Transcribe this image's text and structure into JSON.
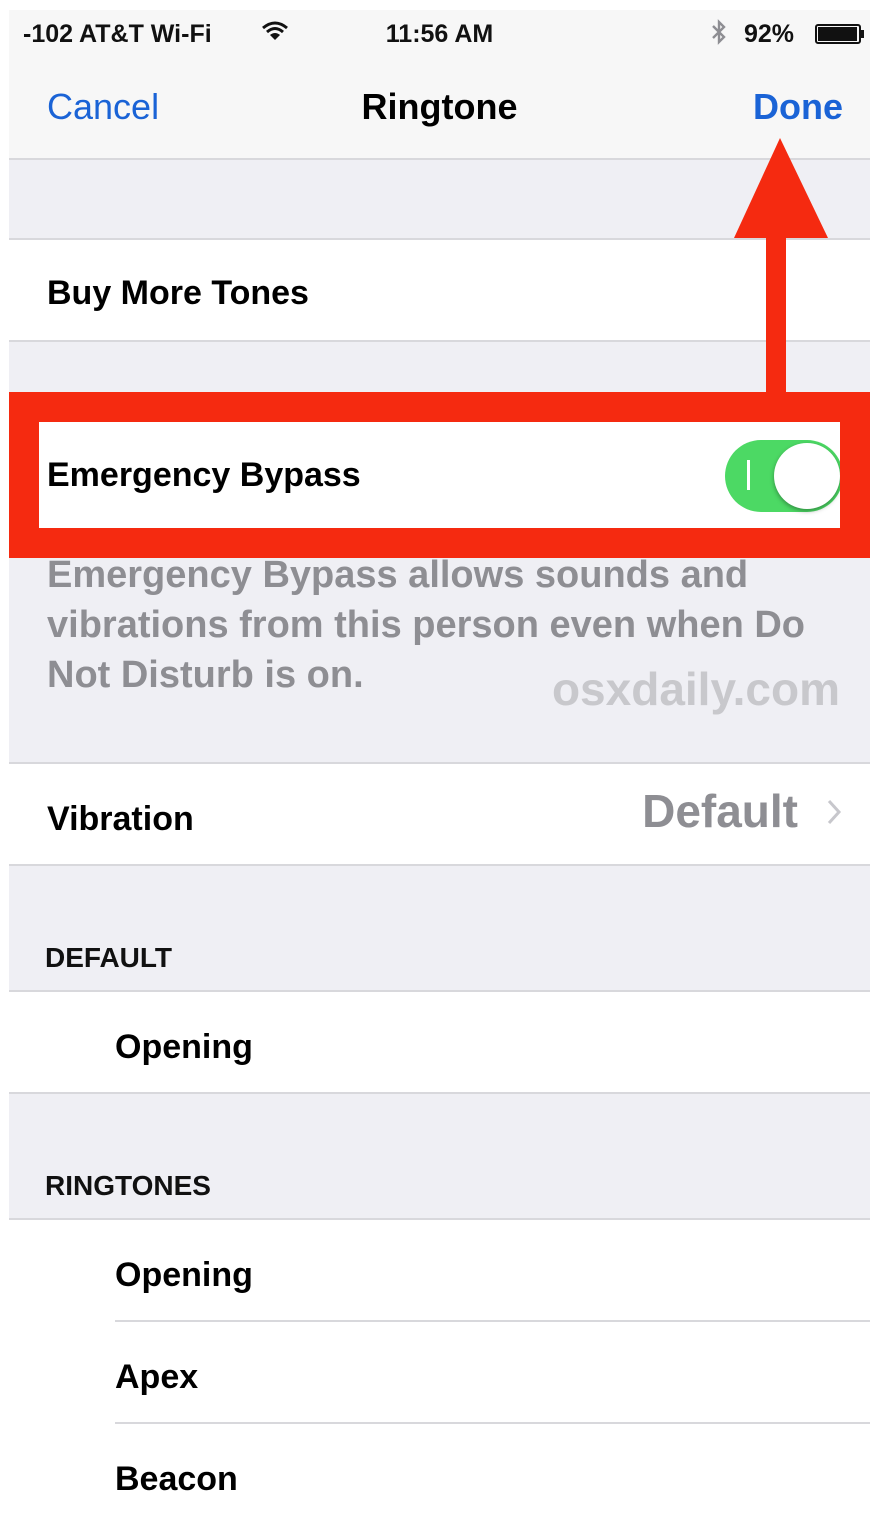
{
  "status_bar": {
    "carrier": "-102 AT&T Wi-Fi",
    "time": "11:56 AM",
    "battery": "92%",
    "wifi_icon": "wifi-icon",
    "bluetooth_icon": "bluetooth-icon",
    "battery_icon": "battery-icon"
  },
  "nav": {
    "cancel": "Cancel",
    "title": "Ringtone",
    "done": "Done"
  },
  "buy_more_tones": "Buy More Tones",
  "emergency_bypass": {
    "label": "Emergency Bypass",
    "enabled": true,
    "description": "Emergency Bypass allows sounds and vibrations from this person even when Do Not Disturb is on."
  },
  "watermark": "osxdaily.com",
  "vibration": {
    "label": "Vibration",
    "value": "Default"
  },
  "sections": {
    "default_header": "DEFAULT",
    "default_items": [
      "Opening"
    ],
    "ringtones_header": "RINGTONES",
    "ringtones_items": [
      "Opening",
      "Apex",
      "Beacon"
    ]
  },
  "colors": {
    "accent": "#1a63d6",
    "toggle_on": "#4cd964",
    "annotation": "#f52a10"
  }
}
